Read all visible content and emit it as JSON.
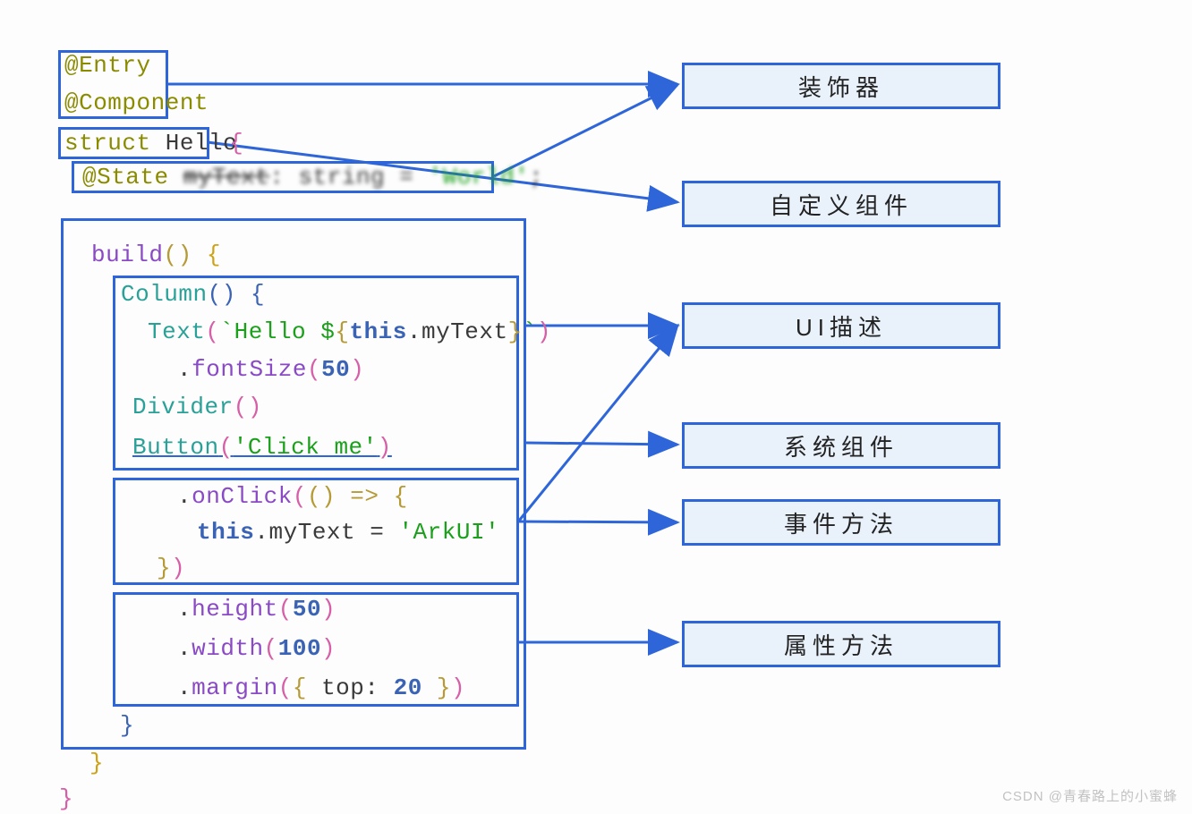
{
  "code": {
    "entry": "@Entry",
    "component": "@Component",
    "struct": "struct",
    "structName": " Hello",
    "braceOpen": " {",
    "stateKw": "@State ",
    "stateVar": "myText",
    "stateRest": ": string = ",
    "stateStr": "'World'",
    "stateSemi": ";",
    "buildName": "build",
    "buildParen": "() ",
    "columnKw": "Column",
    "columnParen": "() ",
    "textKw": "Text",
    "textOpen": "(",
    "textContentA": "`Hello $",
    "textContentB": "{",
    "textThis": "this",
    "textDot": ".myText",
    "textContentC": "}",
    "textContentD": "`",
    "textClose": ")",
    "fontSizeDot": ".",
    "fontSizeKw": "fontSize",
    "fontSizeArg": "50",
    "dividerKw": "Divider",
    "dividerParen": "()",
    "buttonKw": "Button",
    "buttonOpen": "(",
    "buttonStr": "'Click me'",
    "buttonClose": ")",
    "onClickDot": ".",
    "onClickKw": "onClick",
    "onClickOpen": "(",
    "arrowFn": "() => ",
    "thisMy": "this",
    "dotMy": ".myText = ",
    "arkuiStr": "'ArkUI'",
    "cbClose": "}",
    "onClickClose": ")",
    "heightDot": ".",
    "heightKw": "height",
    "heightArg": "50",
    "widthDot": ".",
    "widthKw": "width",
    "widthArg": "100",
    "marginDot": ".",
    "marginKw": "margin",
    "marginOpen": "(",
    "marginBraceO": "{ ",
    "topKw": "top",
    "topColon": ": ",
    "topVal": "20",
    "marginBraceC": " }",
    "marginClose": ")",
    "colClose": "}",
    "buildClose": "}",
    "structClose": "}"
  },
  "labels": {
    "decorator": "装饰器",
    "customComp": "自定义组件",
    "uiDesc": "UI描述",
    "sysComp": "系统组件",
    "eventMethod": "事件方法",
    "attrMethod": "属性方法"
  },
  "watermark": "CSDN @青春路上的小蜜蜂"
}
